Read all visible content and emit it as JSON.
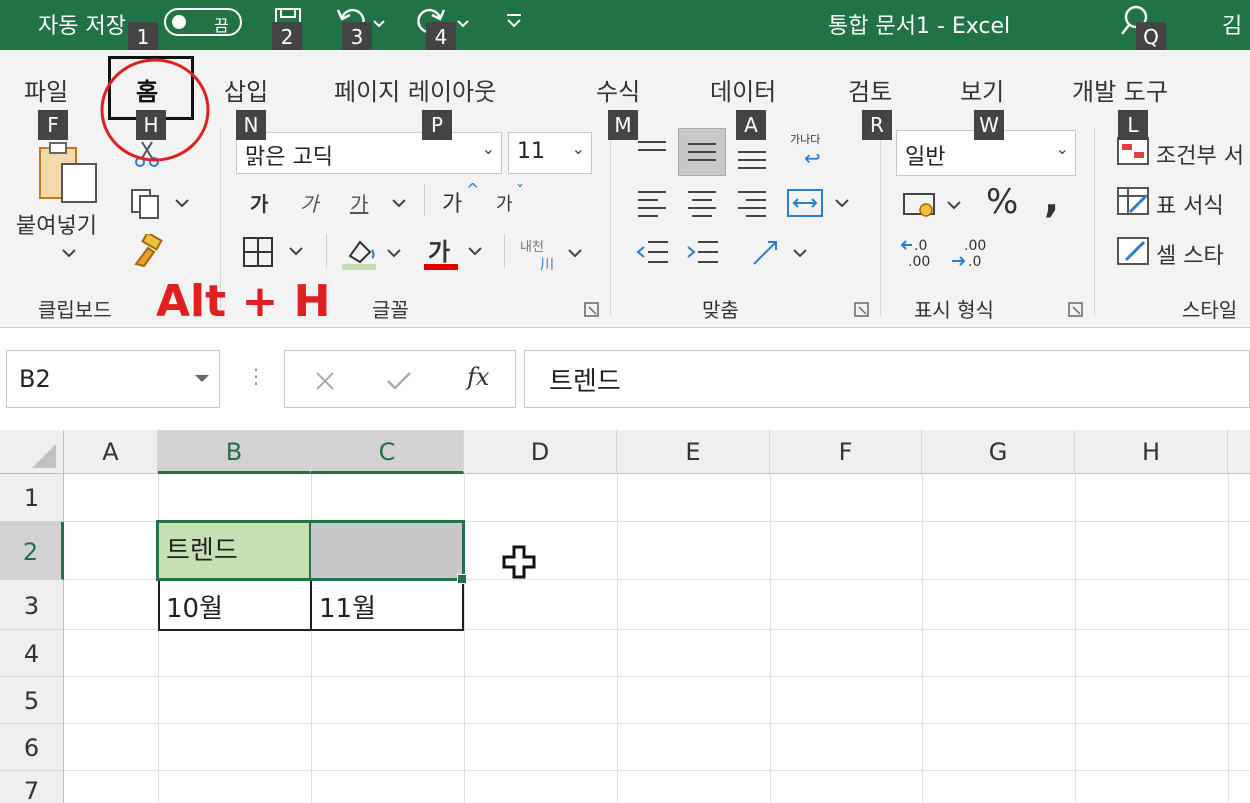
{
  "titlebar": {
    "autosave_label": "자동 저장",
    "autosave_state": "끔",
    "doc_title": "통합 문서1  -  Excel",
    "user_initial": "김",
    "keytips": [
      "1",
      "2",
      "3",
      "4",
      "Q"
    ]
  },
  "tabs": [
    {
      "label": "파일",
      "keytip": "F"
    },
    {
      "label": "홈",
      "keytip": "H"
    },
    {
      "label": "삽입",
      "keytip": "N"
    },
    {
      "label": "페이지 레이아웃",
      "keytip": "P"
    },
    {
      "label": "수식",
      "keytip": "M"
    },
    {
      "label": "데이터",
      "keytip": "A"
    },
    {
      "label": "검토",
      "keytip": "R"
    },
    {
      "label": "보기",
      "keytip": "W"
    },
    {
      "label": "개발 도구",
      "keytip": "L"
    }
  ],
  "ribbon": {
    "clipboard": {
      "paste_label": "붙여넣기",
      "group_label": "클립보드"
    },
    "font": {
      "font_name": "맑은 고딕",
      "font_size": "11",
      "group_label": "글꼴",
      "bold_glyph": "가",
      "italic_glyph": "가",
      "underline_glyph": "가",
      "grow_glyph": "가",
      "shrink_glyph": "가",
      "color_glyph": "가",
      "phonetic_glyph": "내천"
    },
    "alignment": {
      "group_label": "맞춤",
      "wrap_glyph": "가나다"
    },
    "number": {
      "format": "일반",
      "group_label": "표시 형식",
      "percent": "%",
      "comma": ","
    },
    "styles": {
      "conditional": "조건부 서",
      "table_format": "표 서식",
      "cell_style": "셀 스타",
      "group_label": "스타일"
    }
  },
  "annotation": "Alt + H",
  "formula_bar": {
    "name_box": "B2",
    "fx": "fx",
    "content": "트렌드"
  },
  "columns": [
    "A",
    "B",
    "C",
    "D",
    "E",
    "F",
    "G",
    "H"
  ],
  "rows": [
    "1",
    "2",
    "3",
    "4",
    "5",
    "6",
    "7"
  ],
  "cells": {
    "B2": "트렌드",
    "B3": "10월",
    "C3": "11월"
  },
  "colors": {
    "excel_green": "#217346",
    "selection_fill": "#c6e0b4",
    "annotation_red": "#e02020"
  }
}
